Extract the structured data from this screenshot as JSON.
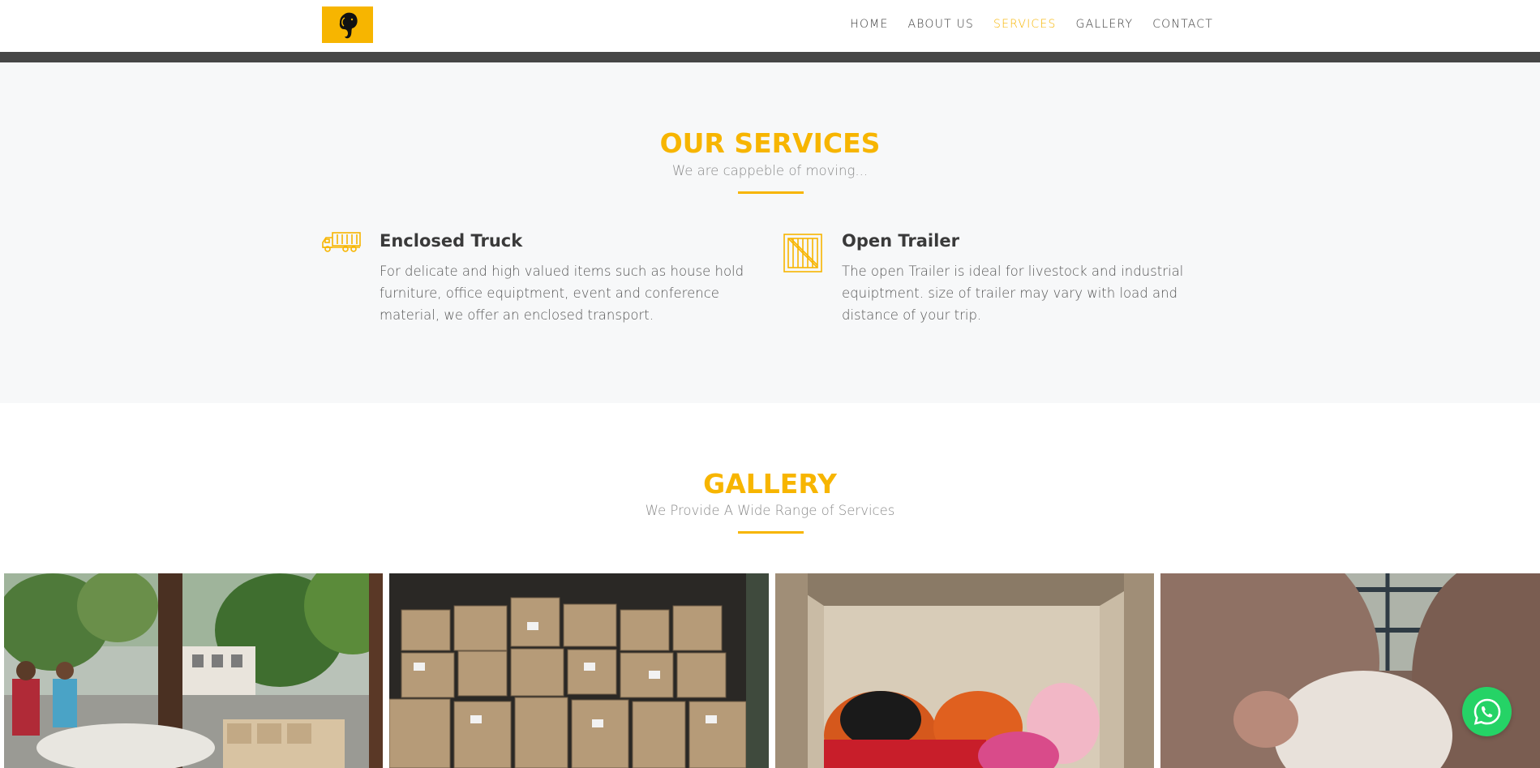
{
  "nav": {
    "items": [
      {
        "label": "HOME"
      },
      {
        "label": "ABOUT US"
      },
      {
        "label": "SERVICES"
      },
      {
        "label": "GALLERY"
      },
      {
        "label": "CONTACT"
      }
    ],
    "active": "SERVICES"
  },
  "services": {
    "title": "OUR SERVICES",
    "subtitle": "We are cappeble of moving...",
    "items": [
      {
        "icon": "truck-icon",
        "title": "Enclosed Truck",
        "desc": "For delicate and high valued items such as house hold furniture, office equiptment, event and conference material, we offer an enclosed transport."
      },
      {
        "icon": "crate-icon",
        "title": "Open Trailer",
        "desc": "The open Trailer is ideal for livestock and industrial equiptment. size of trailer may vary with load and distance of your trip."
      }
    ]
  },
  "gallery": {
    "title": "GALLERY",
    "subtitle": "We Provide A Wide Range of Services",
    "images": [
      {
        "name": "gallery-photo-house-move"
      },
      {
        "name": "gallery-photo-boxes"
      },
      {
        "name": "gallery-photo-truck-load"
      },
      {
        "name": "gallery-photo-livestock"
      }
    ]
  },
  "colors": {
    "accent": "#f7b500",
    "dark_strip": "#464646",
    "whatsapp": "#25d366"
  }
}
